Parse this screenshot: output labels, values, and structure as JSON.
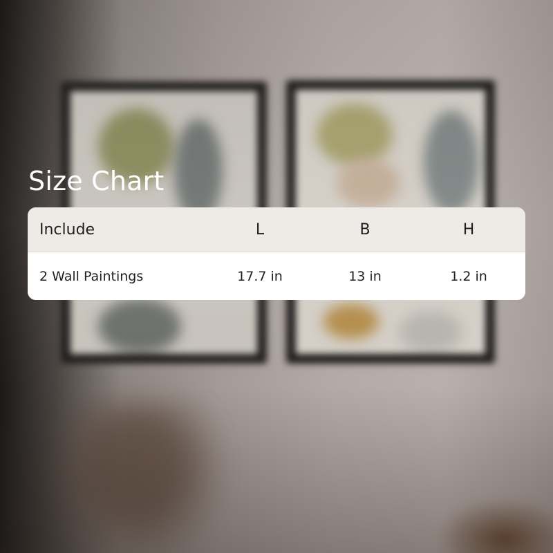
{
  "title": "Size Chart",
  "table": {
    "headers": [
      "Include",
      "L",
      "B",
      "H"
    ],
    "rows": [
      [
        "2 Wall Paintings",
        "17.7 in",
        "13 in",
        "1.2 in"
      ]
    ]
  },
  "colors": {
    "header_bg": "#eeebe7",
    "body_bg": "#ffffff",
    "title_text": "#ffffff",
    "cell_text": "#1f1f1f"
  }
}
